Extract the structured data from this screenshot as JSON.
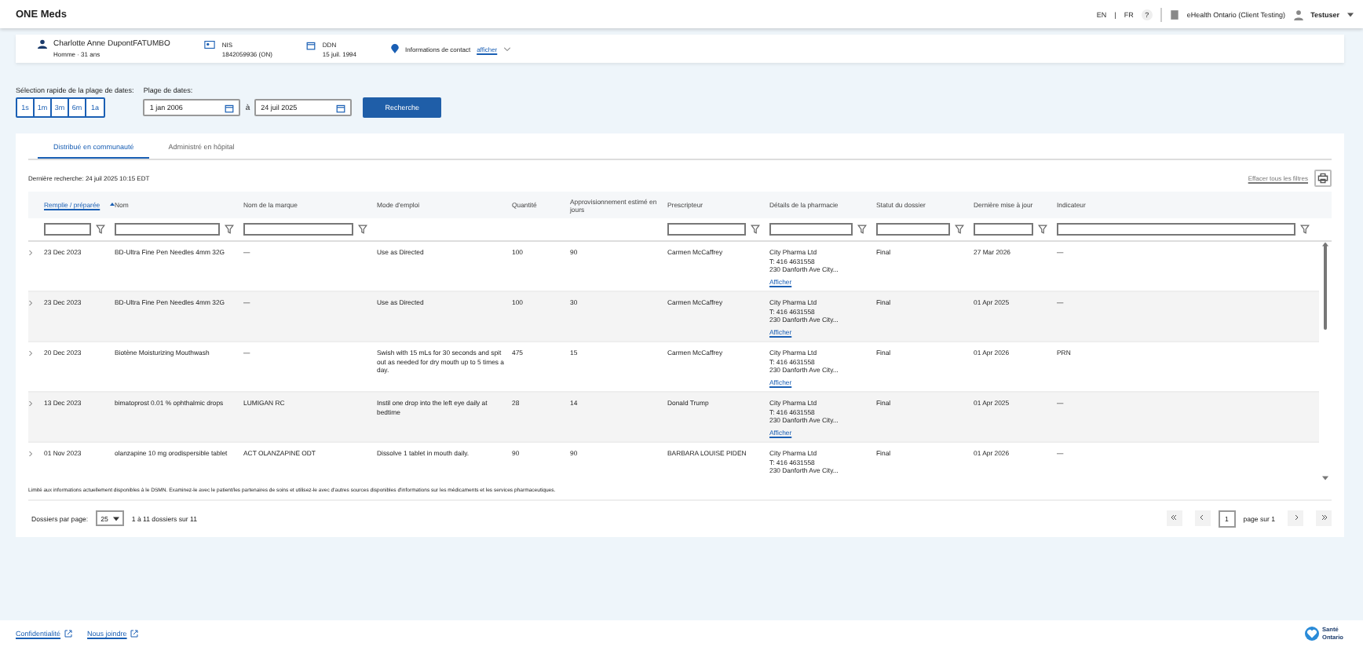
{
  "app_bar": {
    "title": "ONE Meds",
    "languages": [
      "EN",
      "FR"
    ],
    "language_separator": "|",
    "help": "?",
    "organization": "eHealth Ontario (Client Testing)",
    "user": "Testuser"
  },
  "patient": {
    "name": "Charlotte Anne DupontFATUMBO",
    "sex_age": "Homme · 31 ans",
    "id_label": "NIS",
    "id_value": "1842059936 (ON)",
    "dob_label": "DDN",
    "dob_value": "15 juil. 1994",
    "contact_label": "Informations de contact",
    "contact_link": "afficher"
  },
  "date_filter": {
    "quick_label": "Sélection rapide de la plage de dates:",
    "quick_options": [
      {
        "label": "1s",
        "selected": false
      },
      {
        "label": "1m",
        "selected": false
      },
      {
        "label": "3m",
        "selected": false
      },
      {
        "label": "6m",
        "selected": false
      },
      {
        "label": "1a",
        "selected": false
      }
    ],
    "range_label": "Plage de dates:",
    "from": "1 jan 2006",
    "separator": "à",
    "to": "24 juil 2025",
    "search_button": "Recherche"
  },
  "tabs": [
    {
      "label": "Distribué en communauté",
      "selected": true
    },
    {
      "label": "Administré en hôpital",
      "selected": false
    }
  ],
  "last_search": "Dernière recherche: 24 juil 2025 10:15 EDT",
  "clear_filters": "Effacer tous les filtres",
  "table": {
    "columns": [
      {
        "label": "Remplie / préparée",
        "sorted": true,
        "filter": true
      },
      {
        "label": "Nom",
        "sorted": false,
        "filter": true
      },
      {
        "label": "Nom de la marque",
        "sorted": false,
        "filter": true
      },
      {
        "label": "Mode d'emploi",
        "sorted": false,
        "filter": false
      },
      {
        "label": "Quantité",
        "sorted": false,
        "filter": false
      },
      {
        "label": "Approvisionnement estimé en jours",
        "sorted": false,
        "filter": false
      },
      {
        "label": "Prescripteur",
        "sorted": false,
        "filter": true
      },
      {
        "label": "Détails de la pharmacie",
        "sorted": false,
        "filter": true
      },
      {
        "label": "Statut du dossier",
        "sorted": false,
        "filter": true
      },
      {
        "label": "Dernière mise à jour",
        "sorted": false,
        "filter": true
      },
      {
        "label": "Indicateur",
        "sorted": false,
        "filter": true
      }
    ],
    "rows": [
      {
        "filled": "23 Dec 2023",
        "name": "BD-Ultra Fine Pen Needles 4mm 32G",
        "brand": "—",
        "directions": "Use as Directed",
        "quantity": "100",
        "days": "90",
        "prescriber": "Carmen McCaffrey",
        "pharmacy": [
          "City Pharma Ltd",
          "T: 416 4631558",
          "230 Danforth Ave City..."
        ],
        "pharmacy_link": "Afficher",
        "status": "Final",
        "updated": "27 Mar 2026",
        "indicator": "—"
      },
      {
        "filled": "23 Dec 2023",
        "name": "BD-Ultra Fine Pen Needles 4mm 32G",
        "brand": "—",
        "directions": "Use as Directed",
        "quantity": "100",
        "days": "30",
        "prescriber": "Carmen McCaffrey",
        "pharmacy": [
          "City Pharma Ltd",
          "T: 416 4631558",
          "230 Danforth Ave City..."
        ],
        "pharmacy_link": "Afficher",
        "status": "Final",
        "updated": "01 Apr 2025",
        "indicator": "—"
      },
      {
        "filled": "20 Dec 2023",
        "name": "Biotène Moisturizing Mouthwash",
        "brand": "—",
        "directions": "Swish with 15 mLs for 30 seconds and spit out as needed for dry mouth up to 5 times a day.",
        "quantity": "475",
        "days": "15",
        "prescriber": "Carmen McCaffrey",
        "pharmacy": [
          "City Pharma Ltd",
          "T: 416 4631558",
          "230 Danforth Ave City..."
        ],
        "pharmacy_link": "Afficher",
        "status": "Final",
        "updated": "01 Apr 2026",
        "indicator": "PRN"
      },
      {
        "filled": "13 Dec 2023",
        "name": "bimatoprost 0.01 % ophthalmic drops",
        "brand": "LUMIGAN RC",
        "directions": "Instil one drop into the left eye daily at bedtime",
        "quantity": "28",
        "days": "14",
        "prescriber": "Donald Trump",
        "pharmacy": [
          "City Pharma Ltd",
          "T: 416 4631558",
          "230 Danforth Ave City..."
        ],
        "pharmacy_link": "Afficher",
        "status": "Final",
        "updated": "01 Apr 2025",
        "indicator": "—"
      },
      {
        "filled": "01 Nov 2023",
        "name": "olanzapine 10 mg orodispersible tablet",
        "brand": "ACT OLANZAPINE ODT",
        "directions": "Dissolve 1 tablet in mouth daily.",
        "quantity": "90",
        "days": "90",
        "prescriber": "BARBARA LOUISE PIDEN",
        "pharmacy": [
          "City Pharma Ltd",
          "T: 416 4631558",
          "230 Danforth Ave City..."
        ],
        "status": "Final",
        "updated": "01 Apr 2026",
        "indicator": "—"
      }
    ]
  },
  "disclaimer": "Limité aux informations actuellement disponibles à le DSMN. Examinez-le avec le patient/les partenaires de soins et utilisez-le avec d'autres sources disponibles d'informations sur les médicaments et les services pharmaceutiques.",
  "pagination": {
    "per_page_label": "Dossiers par page:",
    "per_page": "25",
    "range": "1 à 11 dossiers sur 11",
    "page": "1",
    "page_of": "page sur 1"
  },
  "footer": {
    "links": [
      "Confidentialité",
      "Nous joindre"
    ],
    "brand": "Santé Ontario"
  }
}
